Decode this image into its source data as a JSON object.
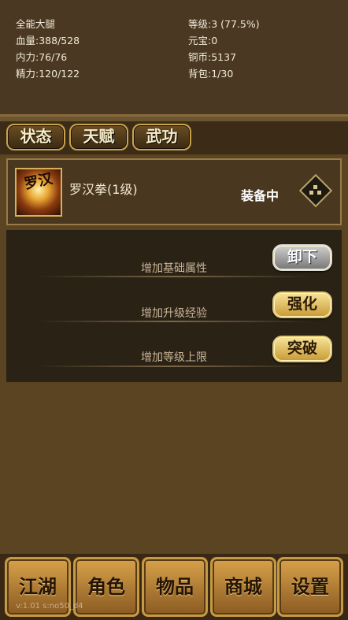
{
  "status": {
    "name": "全能大腿",
    "hp": "血量:388/528",
    "inner_power": "内力:76/76",
    "stamina": "精力:120/122",
    "level": "等级:3 (77.5%)",
    "yuanbao": "元宝:0",
    "copper": "铜币:5137",
    "bag": "背包:1/30"
  },
  "tabs": [
    {
      "label": "状态"
    },
    {
      "label": "天赋"
    },
    {
      "label": "武功"
    }
  ],
  "skill": {
    "icon_text": "罗汉",
    "name": "罗汉拳(1级)",
    "status": "装备中"
  },
  "actions": [
    {
      "label": "增加基础属性",
      "button": "卸下"
    },
    {
      "label": "增加升级经验",
      "button": "强化"
    },
    {
      "label": "增加等级上限",
      "button": "突破"
    }
  ],
  "nav": [
    {
      "label": "江湖"
    },
    {
      "label": "角色"
    },
    {
      "label": "物品"
    },
    {
      "label": "商城"
    },
    {
      "label": "设置"
    }
  ],
  "version": "v:1.01 s:no50_d4",
  "colors": {
    "panel": "#4a3822",
    "gold": "#c9a24e",
    "dark_panel": "#2b2216"
  }
}
